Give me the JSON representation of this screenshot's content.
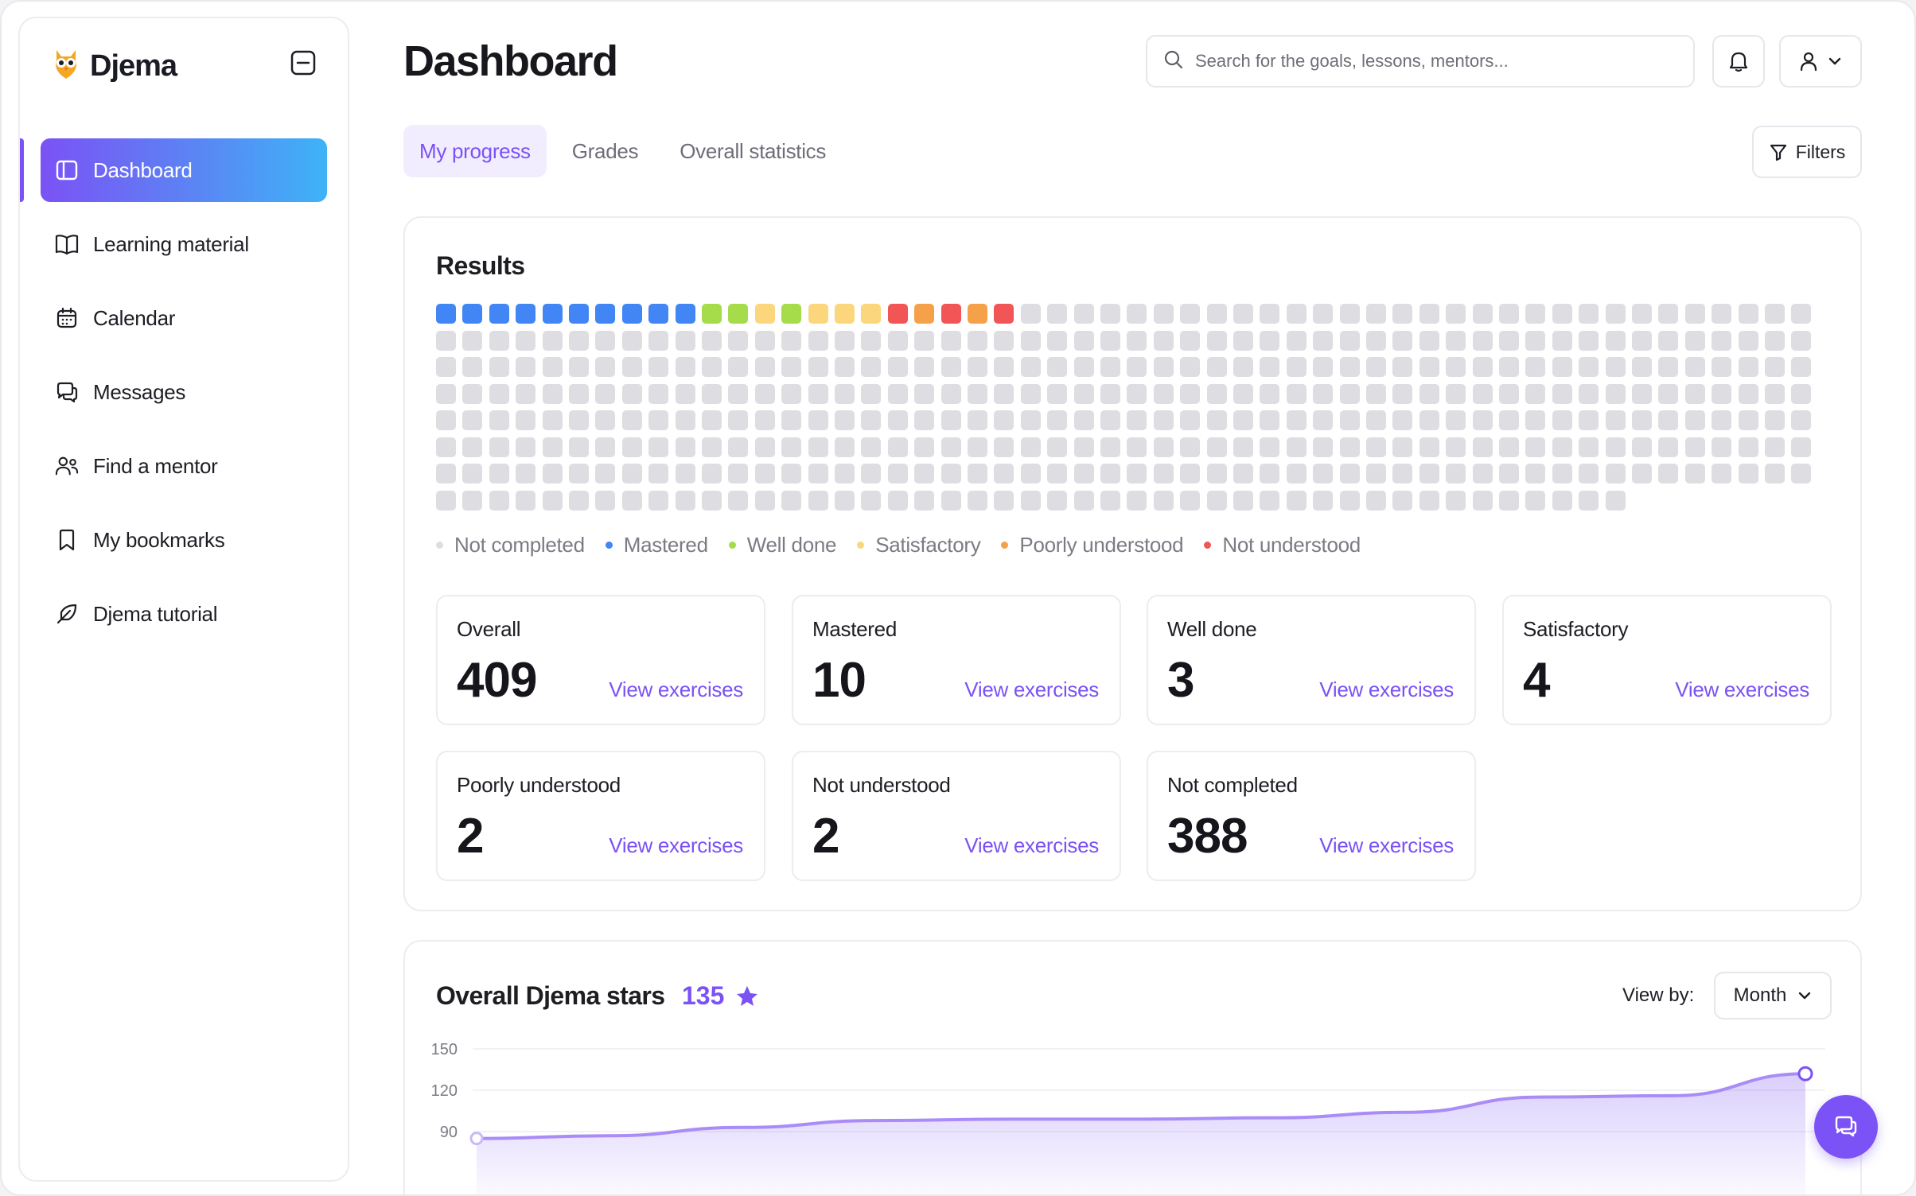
{
  "app": {
    "brand": "Djema"
  },
  "sidebar": {
    "items": [
      {
        "label": "Dashboard",
        "icon": "layout-icon",
        "active": true
      },
      {
        "label": "Learning material",
        "icon": "book-open-icon"
      },
      {
        "label": "Calendar",
        "icon": "calendar-icon"
      },
      {
        "label": "Messages",
        "icon": "messages-icon"
      },
      {
        "label": "Find a mentor",
        "icon": "user-plus-icon"
      },
      {
        "label": "My bookmarks",
        "icon": "bookmark-icon"
      },
      {
        "label": "Djema tutorial",
        "icon": "feather-icon"
      }
    ]
  },
  "header": {
    "title": "Dashboard",
    "search_placeholder": "Search for the goals, lessons, mentors..."
  },
  "tabs": [
    {
      "label": "My progress",
      "active": true
    },
    {
      "label": "Grades"
    },
    {
      "label": "Overall statistics"
    }
  ],
  "filters_label": "Filters",
  "results": {
    "title": "Results",
    "colors": {
      "not_completed": "#dedee2",
      "mastered": "#4285f4",
      "well_done": "#a6dc4a",
      "satisfactory": "#fbd67c",
      "poorly_understood": "#f5a14a",
      "not_understood": "#f25555"
    },
    "sequence": [
      "mastered",
      "mastered",
      "mastered",
      "mastered",
      "mastered",
      "mastered",
      "mastered",
      "mastered",
      "mastered",
      "mastered",
      "well_done",
      "well_done",
      "satisfactory",
      "well_done",
      "satisfactory",
      "satisfactory",
      "satisfactory",
      "not_understood",
      "poorly_understood",
      "not_understood",
      "poorly_understood",
      "not_understood"
    ],
    "legend": [
      {
        "key": "not_completed",
        "label": "Not completed"
      },
      {
        "key": "mastered",
        "label": "Mastered"
      },
      {
        "key": "well_done",
        "label": "Well done"
      },
      {
        "key": "satisfactory",
        "label": "Satisfactory"
      },
      {
        "key": "poorly_understood",
        "label": "Poorly understood"
      },
      {
        "key": "not_understood",
        "label": "Not understood"
      }
    ],
    "stats": [
      {
        "label": "Overall",
        "value": "409",
        "link": "View exercises"
      },
      {
        "label": "Mastered",
        "value": "10",
        "link": "View exercises"
      },
      {
        "label": "Well done",
        "value": "3",
        "link": "View exercises"
      },
      {
        "label": "Satisfactory",
        "value": "4",
        "link": "View exercises"
      },
      {
        "label": "Poorly understood",
        "value": "2",
        "link": "View exercises"
      },
      {
        "label": "Not understood",
        "value": "2",
        "link": "View exercises"
      },
      {
        "label": "Not completed",
        "value": "388",
        "link": "View exercises"
      }
    ]
  },
  "stars": {
    "title": "Overall Djema stars",
    "count": "135",
    "view_by_label": "View by:",
    "view_by_value": "Month",
    "accent": "#7b52f5"
  },
  "chart_data": {
    "type": "area",
    "yticks": [
      150,
      120,
      90
    ],
    "ylim": [
      90,
      150
    ],
    "x": [
      0,
      1,
      2,
      3,
      4,
      5,
      6,
      7,
      8,
      9,
      10
    ],
    "values": [
      85,
      87,
      93,
      98,
      99,
      99,
      100,
      104,
      115,
      116,
      132
    ]
  }
}
